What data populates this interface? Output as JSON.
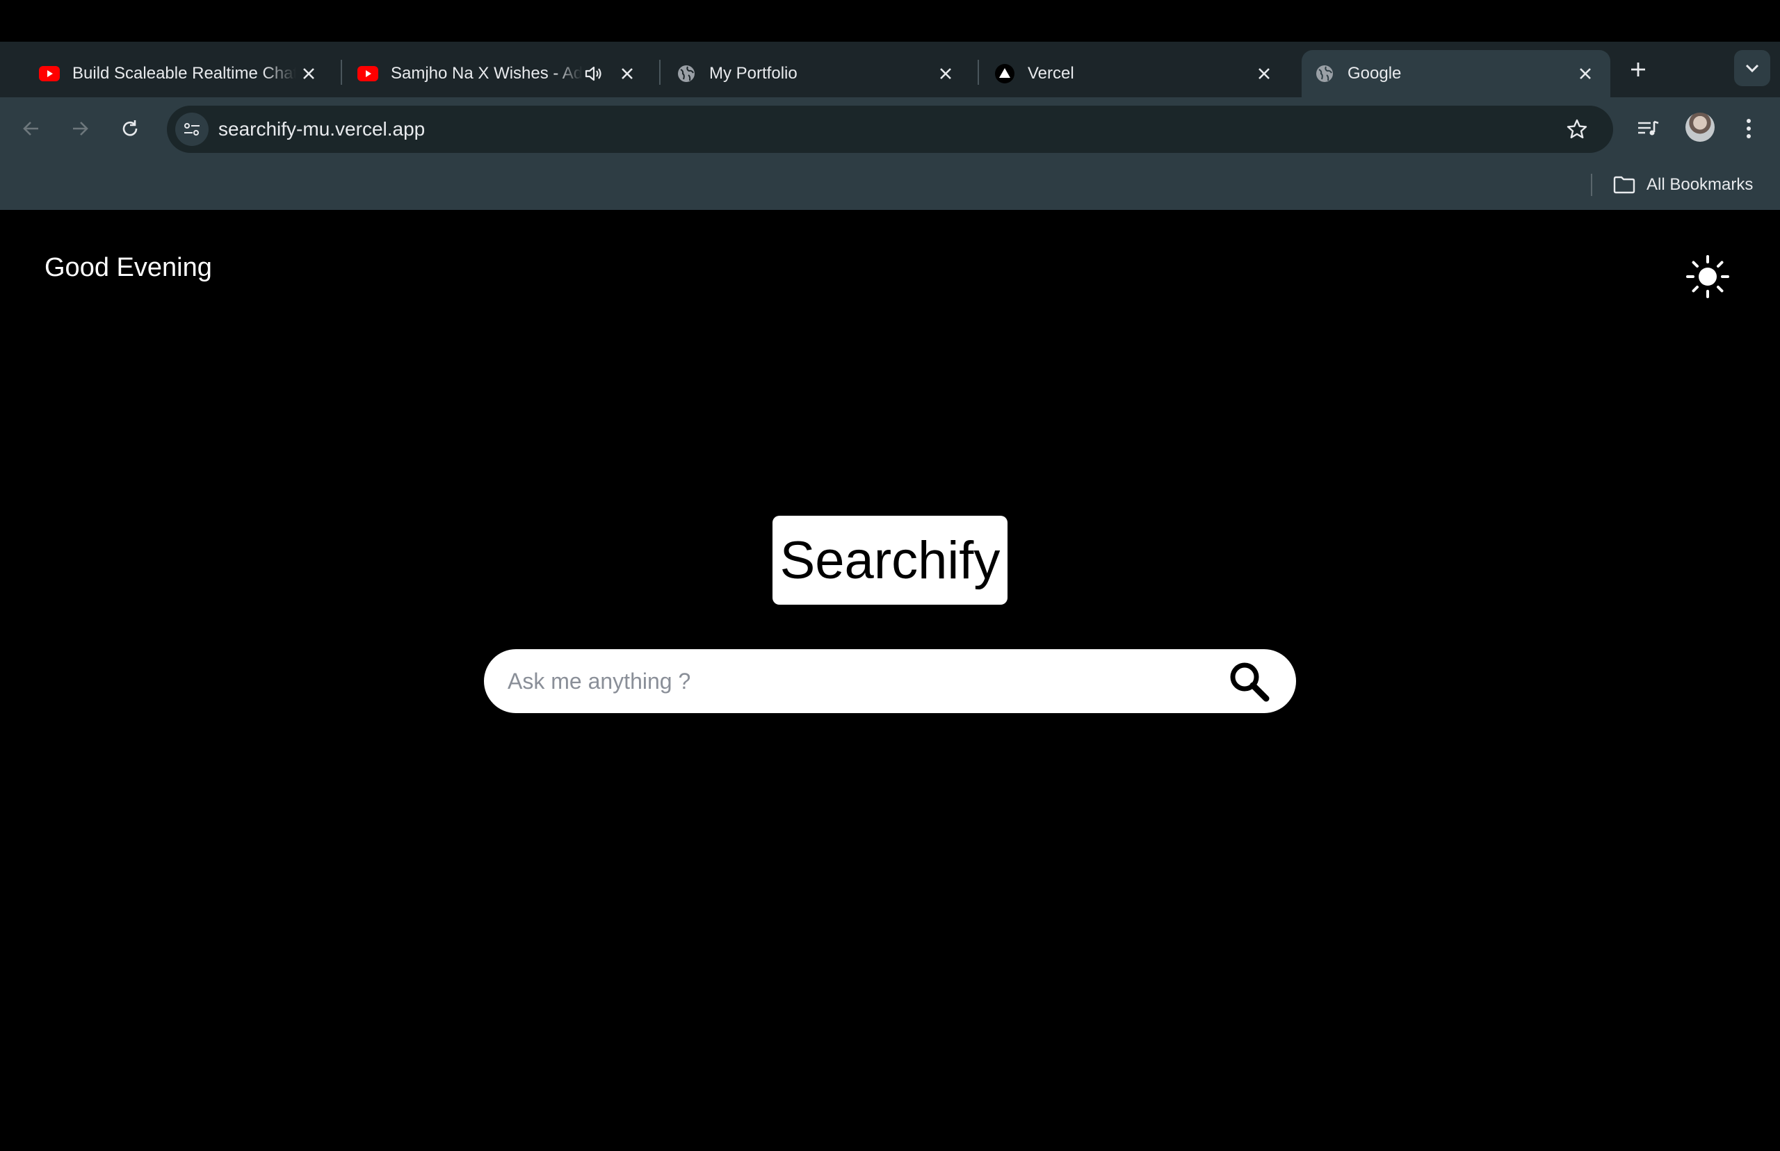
{
  "browser": {
    "tabs": [
      {
        "title": "Build Scaleable Realtime Chat App",
        "favicon": "youtube-icon",
        "active": false,
        "audio": false
      },
      {
        "title": "Samjho Na X Wishes - Aditya Rikhari",
        "favicon": "youtube-icon",
        "active": false,
        "audio": true
      },
      {
        "title": "My Portfolio",
        "favicon": "globe-icon",
        "active": false,
        "audio": false
      },
      {
        "title": "Vercel",
        "favicon": "vercel-icon",
        "active": false,
        "audio": false
      },
      {
        "title": "Google",
        "favicon": "globe-icon",
        "active": true,
        "audio": false
      }
    ],
    "url": "searchify-mu.vercel.app",
    "bookmarks_label": "All Bookmarks"
  },
  "page": {
    "greeting": "Good Evening",
    "logo_text": "Searchify",
    "search_placeholder": "Ask me anything ?",
    "search_value": ""
  },
  "colors": {
    "background": "#000000",
    "tabstrip": "#1c2529",
    "toolbar": "#2e3d44",
    "omnibox": "#1b2629",
    "youtube_red": "#ff0000"
  }
}
